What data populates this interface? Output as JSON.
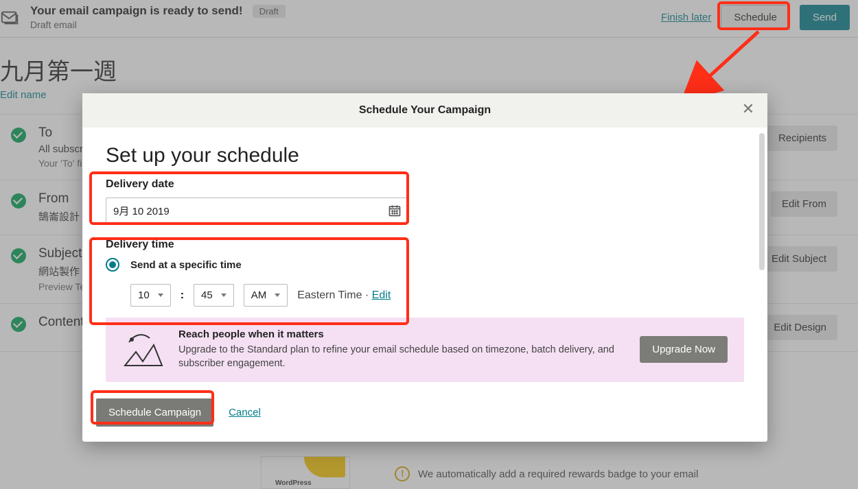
{
  "topbar": {
    "title": "Your email campaign is ready to send!",
    "badge": "Draft",
    "subtitle": "Draft email",
    "finish_later": "Finish later",
    "schedule_btn": "Schedule",
    "send_btn": "Send"
  },
  "campaign": {
    "name": "九月第一週",
    "edit_name": "Edit name"
  },
  "rows": {
    "to": {
      "title": "To",
      "sub": "All subscribers",
      "sub2": "Your 'To' field",
      "btn": "Recipients"
    },
    "from": {
      "title": "From",
      "sub": "鵠崙設計",
      "btn": "Edit From"
    },
    "subject": {
      "title": "Subject",
      "sub": "網站製作",
      "sub2": "Preview Text",
      "btn": "Edit Subject"
    },
    "content": {
      "title": "Content",
      "btn": "Edit Design"
    }
  },
  "modal": {
    "header": "Schedule Your Campaign",
    "title": "Set up your schedule",
    "delivery_date_label": "Delivery date",
    "delivery_date_value": "9月 10 2019",
    "delivery_time_label": "Delivery time",
    "specific_time_label": "Send at a specific time",
    "hour": "10",
    "minute": "45",
    "ampm": "AM",
    "colon": ":",
    "tz": "Eastern Time",
    "tz_sep": " · ",
    "tz_edit": "Edit",
    "promo_title": "Reach people when it matters",
    "promo_sub": "Upgrade to the Standard plan to refine your email schedule based on timezone, batch delivery, and subscriber engagement.",
    "upgrade_btn": "Upgrade Now",
    "schedule_campaign_btn": "Schedule Campaign",
    "cancel": "Cancel"
  },
  "rewards": {
    "text": "We automatically add a required rewards badge to your email"
  },
  "preview": {
    "logo": "WordPress"
  }
}
